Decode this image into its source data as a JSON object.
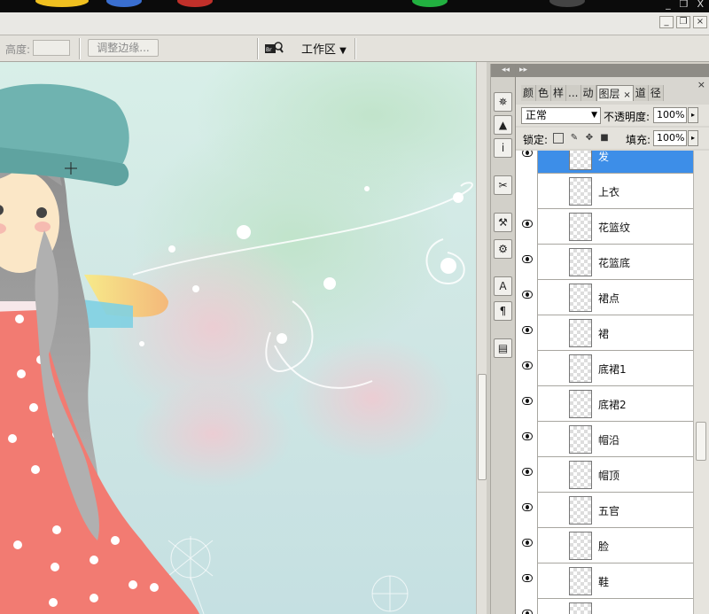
{
  "window": {
    "minimize_label": "_",
    "restore_label": "❐",
    "close_label": "X",
    "doc_minimize_label": "_",
    "doc_restore_label": "❐",
    "doc_close_label": "×"
  },
  "options_bar": {
    "height_label": "高度:",
    "height_value": "",
    "refine_edge_label": "调整边缘...",
    "workspace_label": "工作区",
    "workspace_arrow": "▼"
  },
  "dock": {
    "header": "◂◂",
    "buttons": [
      "navigator-icon",
      "histogram-icon",
      "info-icon",
      "brushes-icon",
      "tool-presets-icon",
      "clone-source-icon",
      "character-icon",
      "paragraph-icon",
      "layer-comps-icon"
    ],
    "button_glyphs": [
      "✵",
      "▲",
      "i",
      "✂",
      "⚒",
      "⚙",
      "A",
      "¶",
      "▤"
    ]
  },
  "layers_panel": {
    "header": "▸▸",
    "close": "×",
    "tabs": [
      "颜",
      "色",
      "样",
      "...",
      "动",
      "图层",
      "道",
      "径"
    ],
    "active_tab": "图层",
    "tab_close": "×",
    "blend_mode": "正常",
    "opacity_label": "不透明度:",
    "opacity_value": "100%",
    "lock_label": "锁定:",
    "lock_icons": [
      "lock-transparent-icon",
      "lock-paint-icon",
      "lock-move-icon",
      "lock-all-icon"
    ],
    "fill_label": "填充:",
    "fill_value": "100%",
    "layers": [
      {
        "name": "发",
        "visible": true,
        "selected": true
      },
      {
        "name": "上衣",
        "visible": false,
        "selected": false
      },
      {
        "name": "花篮纹",
        "visible": true,
        "selected": false
      },
      {
        "name": "花篮底",
        "visible": true,
        "selected": false
      },
      {
        "name": "裙点",
        "visible": true,
        "selected": false
      },
      {
        "name": "裙",
        "visible": true,
        "selected": false
      },
      {
        "name": "底裙1",
        "visible": true,
        "selected": false
      },
      {
        "name": "底裙2",
        "visible": true,
        "selected": false
      },
      {
        "name": "帽沿",
        "visible": true,
        "selected": false
      },
      {
        "name": "帽顶",
        "visible": true,
        "selected": false
      },
      {
        "name": "五官",
        "visible": true,
        "selected": false
      },
      {
        "name": "脸",
        "visible": true,
        "selected": false
      },
      {
        "name": "鞋",
        "visible": true,
        "selected": false
      },
      {
        "name": "",
        "visible": true,
        "selected": false
      }
    ]
  },
  "colors": {
    "selection": "#3d8ee8",
    "hat": "#6fb3b0",
    "dress": "#f27b72",
    "background": "#d6ece6"
  }
}
